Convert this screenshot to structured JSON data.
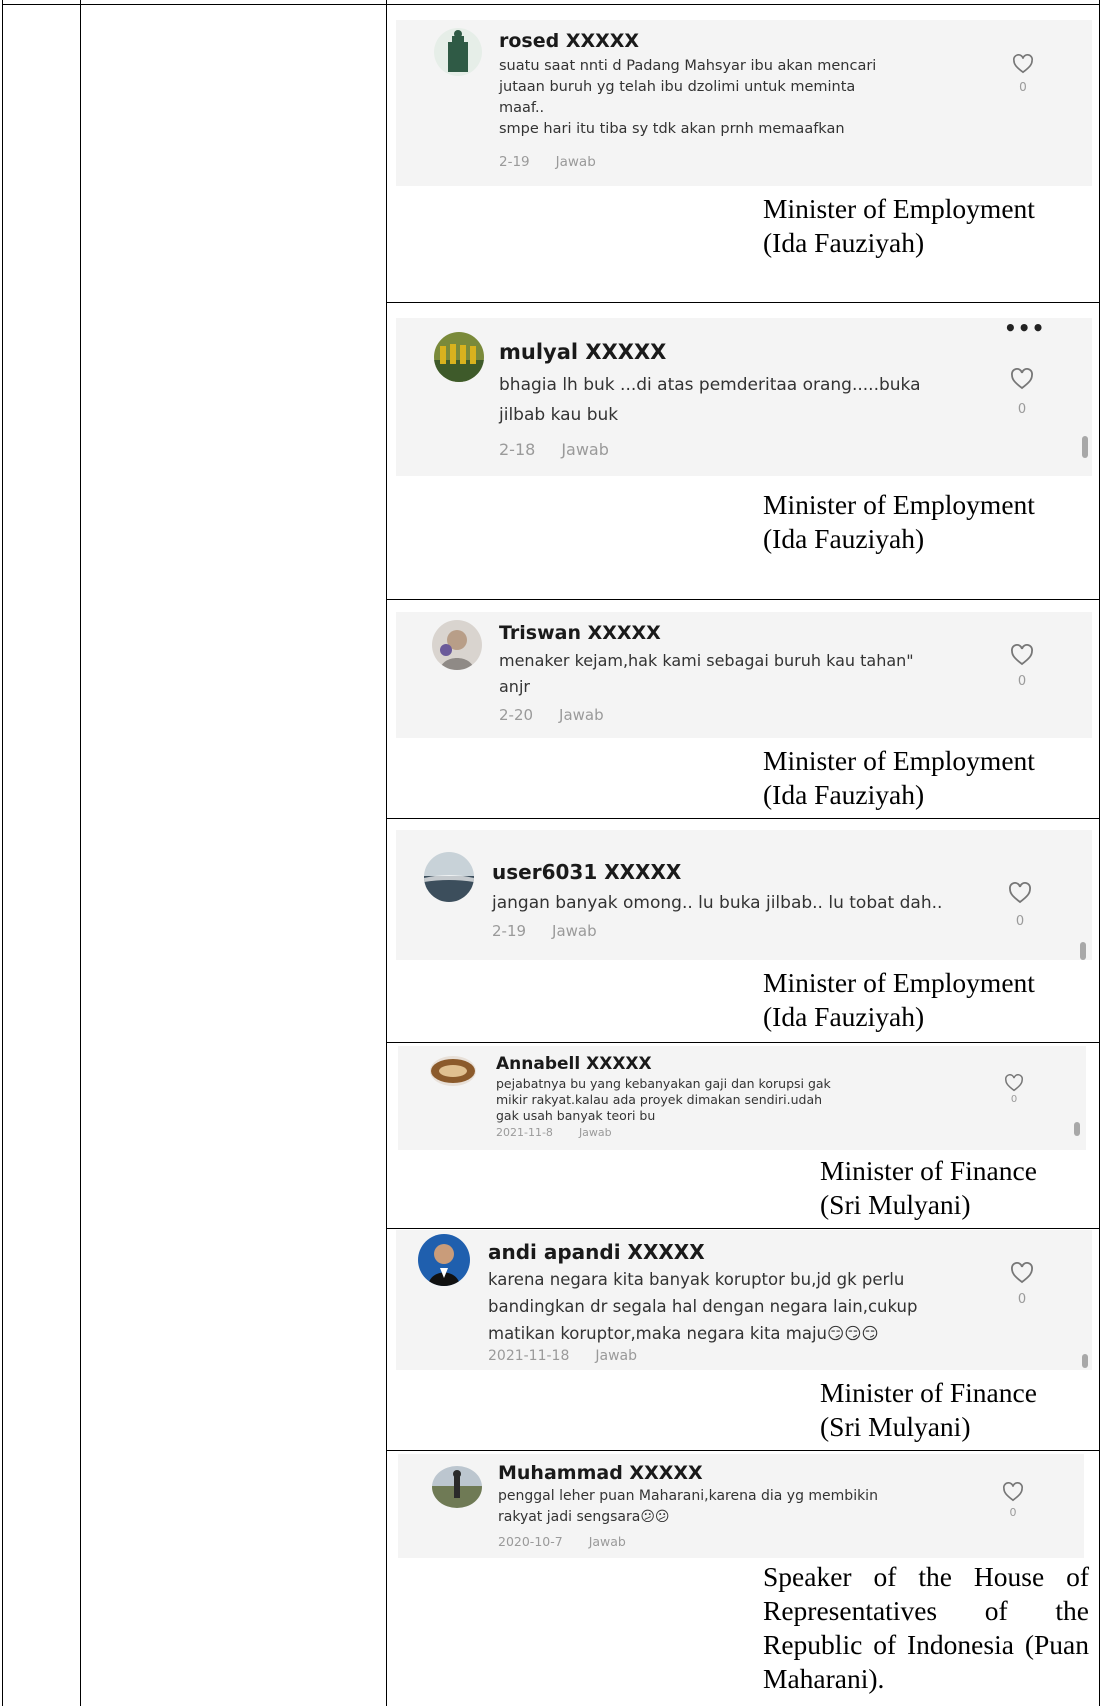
{
  "rows": [
    {
      "comment": {
        "username": "rosed XXXXX",
        "text": "suatu saat nnti d Padang Mahsyar ibu akan mencari\njutaan buruh yg telah ibu dzolimi untuk meminta\nmaaf..\nsmpe hari itu tiba sy tdk akan prnh memaafkan",
        "date": "2-19",
        "reply": "Jawab",
        "likes": "0"
      },
      "caption": "Minister of Employment\n(Ida Fauziyah)"
    },
    {
      "comment": {
        "username": "mulyal XXXXX",
        "text": "bhagia lh buk ...di atas pemderitaa orang.....buka\njilbab kau buk",
        "date": "2-18",
        "reply": "Jawab",
        "likes": "0",
        "more": "•••"
      },
      "caption": "Minister of Employment\n(Ida Fauziyah)"
    },
    {
      "comment": {
        "username": "Triswan XXXXX",
        "text": "menaker kejam,hak kami sebagai buruh kau tahan\"\nanjr",
        "date": "2-20",
        "reply": "Jawab",
        "likes": "0"
      },
      "caption": "Minister of Employment\n(Ida Fauziyah)"
    },
    {
      "comment": {
        "username": "user6031 XXXXX",
        "text": "jangan banyak omong.. lu buka jilbab.. lu tobat dah..",
        "date": "2-19",
        "reply": "Jawab",
        "likes": "0"
      },
      "caption": "Minister of Employment\n(Ida Fauziyah)"
    },
    {
      "comment": {
        "username": "Annabell XXXXX",
        "text": "pejabatnya bu yang kebanyakan gaji dan korupsi gak\nmikir rakyat.kalau ada proyek dimakan sendiri.udah\ngak usah banyak teori bu",
        "date": "2021-11-8",
        "reply": "Jawab",
        "likes": "0"
      },
      "caption": "Minister of Finance\n(Sri Mulyani)"
    },
    {
      "comment": {
        "username": "andi apandi XXXXX",
        "text": "karena negara kita banyak koruptor bu,jd gk perlu\nbandingkan dr segala hal dengan negara lain,cukup\nmatikan koruptor,maka negara kita maju😏😏😏",
        "date": "2021-11-18",
        "reply": "Jawab",
        "likes": "0"
      },
      "caption": "Minister of Finance\n(Sri Mulyani)"
    },
    {
      "comment": {
        "username": "Muhammad XXXXX",
        "text": "penggal leher puan Maharani,karena dia yg membikin\nrakyat jadi sengsara😕😕",
        "date": "2020-10-7",
        "reply": "Jawab",
        "likes": "0"
      },
      "caption": "Speaker of the House of Representatives of the Republic of Indonesia (Puan Maharani)."
    }
  ],
  "colors": {
    "card_background": "#f4f4f4",
    "border": "#000000",
    "meta_text": "#9a9a9a"
  },
  "icons": [
    "heart-outline-icon",
    "more-dots-icon",
    "avatar-image"
  ]
}
